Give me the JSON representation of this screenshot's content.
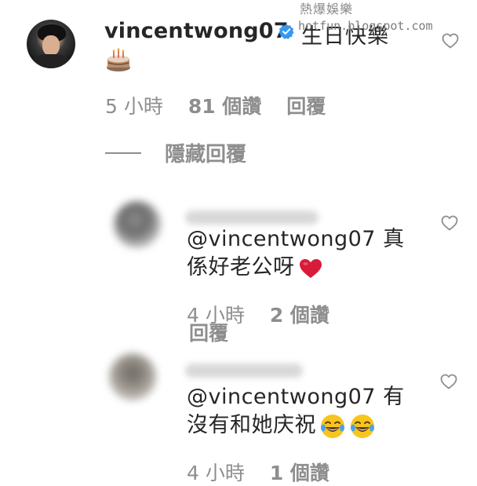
{
  "watermark": {
    "title": "熱爆娛樂",
    "url": "hotfun.blogspot.com"
  },
  "top_comment": {
    "username": "vincentwong07",
    "text": "生日快樂",
    "emoji": "birthday-cake-icon",
    "meta": {
      "time": "5 小時",
      "likes": "81 個讚",
      "reply": "回覆"
    },
    "hide_replies": "隱藏回覆"
  },
  "replies": [
    {
      "mention": "@vincentwong07",
      "text_line1_suffix": "真",
      "text_line2": "係好老公呀",
      "emoji": "red-heart-icon",
      "meta": {
        "time": "4 小時",
        "likes": "2 個讚",
        "reply": "回覆"
      }
    },
    {
      "mention": "@vincentwong07",
      "text_line1_suffix": "有",
      "text_line2": "沒有和她庆祝",
      "emoji": "laughing-tears-icon",
      "meta": {
        "time": "4 小時",
        "likes": "1 個讚"
      }
    }
  ],
  "colors": {
    "text": "#262626",
    "meta": "#8e8e8e",
    "verified": "#3897f0",
    "heart": "#ed4956",
    "background": "#ffffff"
  }
}
